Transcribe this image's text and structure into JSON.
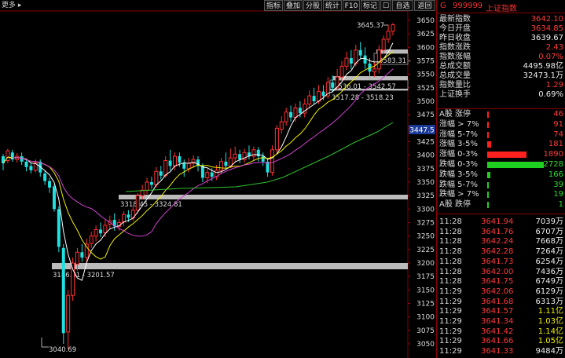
{
  "toolbar": {
    "more": "更多",
    "buttons": [
      "指标",
      "叠加",
      "分股",
      "统计",
      "F10",
      "标记",
      "自选"
    ]
  },
  "chart": {
    "price_axis": [
      "3650",
      "3625",
      "3600",
      "3575",
      "3550",
      "3525",
      "3500",
      "3475",
      "3450",
      "3425",
      "3400",
      "3375",
      "3350",
      "3325",
      "3300",
      "3275",
      "3250",
      "3225",
      "3200",
      "3175",
      "3150",
      "3125",
      "3100",
      "3075",
      "3050"
    ],
    "current_price_tag": "3447.5",
    "annotations": {
      "high": "3645.37",
      "low": "3040.69",
      "zone1": "3583.31 -",
      "zone2": "3536.01 - 3542.57",
      "zone3": "3517.28 - 3518.23",
      "zone4": "3318.45 - 3324.81",
      "zone5": "3186.81 - 3201.57"
    }
  },
  "panel": {
    "title": {
      "prefix": "G",
      "code": "999999",
      "name": "上证指数"
    },
    "stats": [
      {
        "label": "最新指数",
        "value": "3642.10",
        "color": "red"
      },
      {
        "label": "今日开盘",
        "value": "3634.85",
        "color": "red"
      },
      {
        "label": "昨日收盘",
        "value": "3639.67",
        "color": "white"
      },
      {
        "label": "指数涨跌",
        "value": "2.43",
        "color": "red"
      },
      {
        "label": "指数涨幅",
        "value": "0.07%",
        "color": "red"
      },
      {
        "label": "总成交额",
        "value": "4495.98亿",
        "color": "white"
      },
      {
        "label": "总成交量",
        "value": "32473.1万",
        "color": "white"
      },
      {
        "label": "指数量比",
        "value": "1.29",
        "color": "red"
      },
      {
        "label": "上证换手",
        "value": "0.69%",
        "color": "white"
      }
    ],
    "breadth": [
      {
        "label": "A股 涨停",
        "value": "46",
        "color": "red",
        "fill": 0.017
      },
      {
        "label": "涨幅 > 7%",
        "value": "91",
        "color": "red",
        "fill": 0.033
      },
      {
        "label": "涨幅 5-7%",
        "value": "74",
        "color": "red",
        "fill": 0.027
      },
      {
        "label": "涨幅 3-5%",
        "value": "181",
        "color": "red",
        "fill": 0.066
      },
      {
        "label": "涨幅 0-3%",
        "value": "1890",
        "color": "red",
        "fill": 0.69
      },
      {
        "label": "跌幅 0-3%",
        "value": "2728",
        "color": "green",
        "fill": 1.0
      },
      {
        "label": "跌幅 3-5%",
        "value": "166",
        "color": "green",
        "fill": 0.06
      },
      {
        "label": "跌幅 5-7%",
        "value": "39",
        "color": "green",
        "fill": 0.014
      },
      {
        "label": "跌幅 > 7%",
        "value": "19",
        "color": "green",
        "fill": 0.007
      },
      {
        "label": "A股 跌停",
        "value": "1",
        "color": "green",
        "fill": 0.0
      }
    ],
    "ticks": [
      {
        "time": "11:28",
        "price": "3641.94",
        "vol": "7039万",
        "vc": "white"
      },
      {
        "time": "11:28",
        "price": "3641.76",
        "vol": "6707万",
        "vc": "white"
      },
      {
        "time": "11:28",
        "price": "3642.24",
        "vol": "7668万",
        "vc": "white"
      },
      {
        "time": "11:28",
        "price": "3642.28",
        "vol": "7264万",
        "vc": "white"
      },
      {
        "time": "11:28",
        "price": "3641.73",
        "vol": "6254万",
        "vc": "white"
      },
      {
        "time": "11:28",
        "price": "3642.00",
        "vol": "7436万",
        "vc": "white"
      },
      {
        "time": "11:28",
        "price": "3641.75",
        "vol": "6749万",
        "vc": "white"
      },
      {
        "time": "11:29",
        "price": "3642.06",
        "vol": "6129万",
        "vc": "white"
      },
      {
        "time": "11:29",
        "price": "3641.68",
        "vol": "6313万",
        "vc": "white"
      },
      {
        "time": "11:29",
        "price": "3641.57",
        "vol": "1.11亿",
        "vc": "yellow"
      },
      {
        "time": "11:29",
        "price": "3641.34",
        "vol": "1.03亿",
        "vc": "yellow"
      },
      {
        "time": "11:29",
        "price": "3641.42",
        "vol": "1.14亿",
        "vc": "yellow"
      },
      {
        "time": "11:29",
        "price": "3641.66",
        "vol": "1.05亿",
        "vc": "yellow"
      },
      {
        "time": "11:29",
        "price": "3641.33",
        "vol": "9484万",
        "vc": "white"
      }
    ]
  }
}
